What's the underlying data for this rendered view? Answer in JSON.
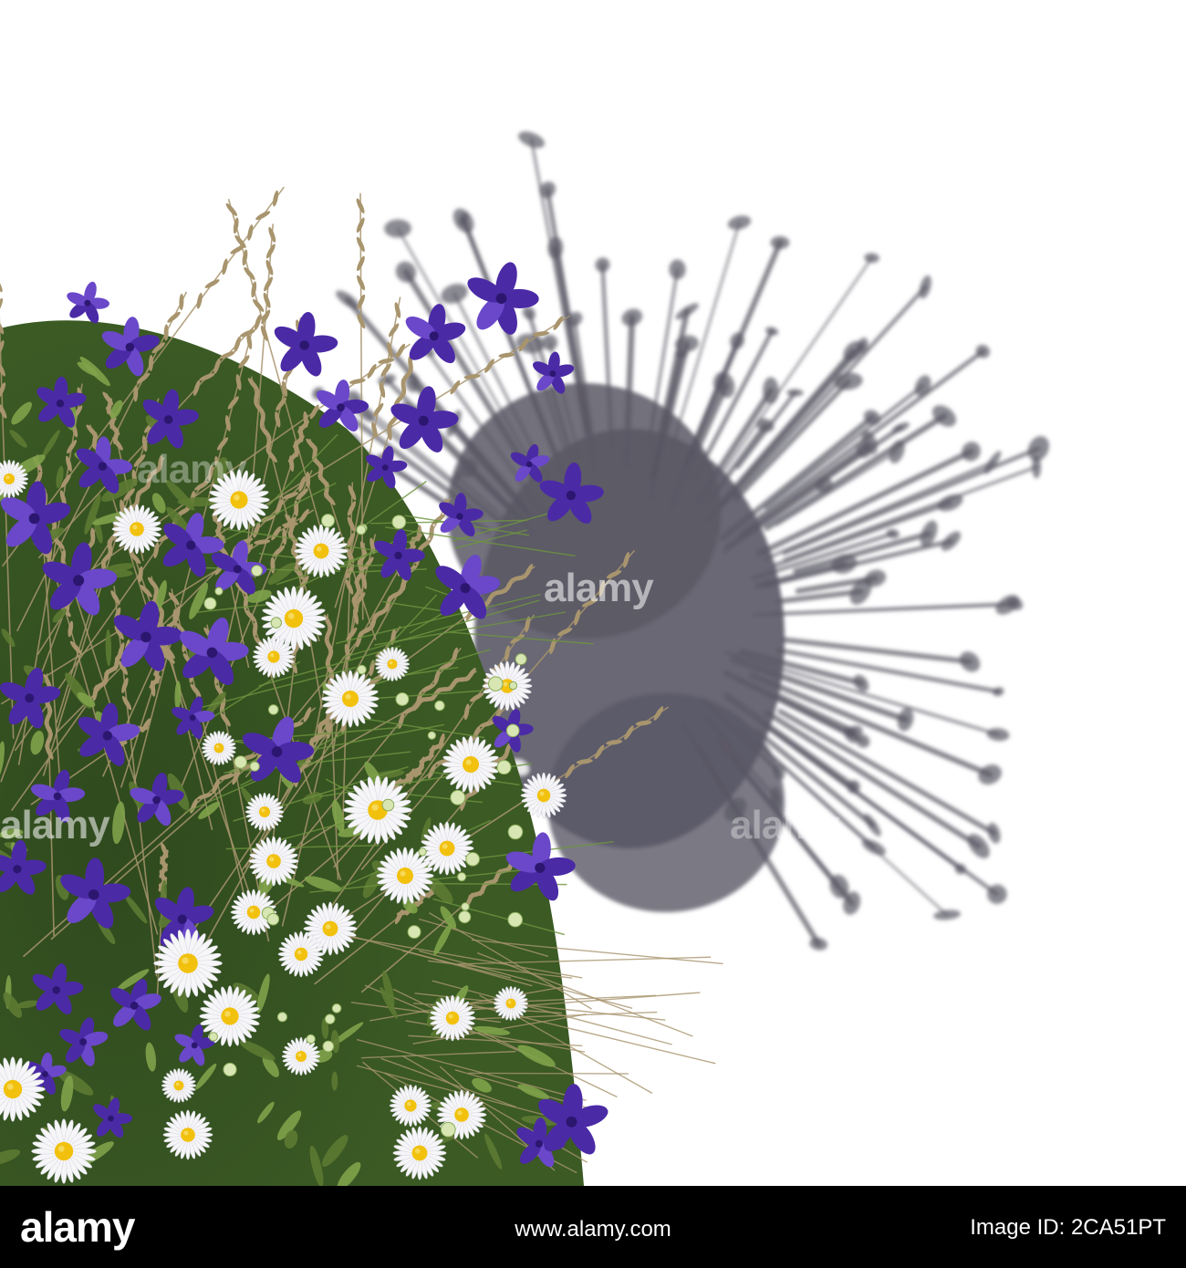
{
  "photo": {
    "subject_icon": "wildflower-bouquet",
    "colors": {
      "background": "#ffffff",
      "shadow": "#5a5865",
      "delphinium": "#4b2aa6",
      "daisy_petal": "#f6f6f8",
      "daisy_center": "#f2c10d",
      "grass": "#a8956e",
      "foliage": "#5d7a33"
    }
  },
  "watermark": {
    "text": "alamy"
  },
  "footer": {
    "logo": "alamy",
    "image_id": "Image ID: 2CA51PT",
    "site": "www.alamy.com"
  }
}
